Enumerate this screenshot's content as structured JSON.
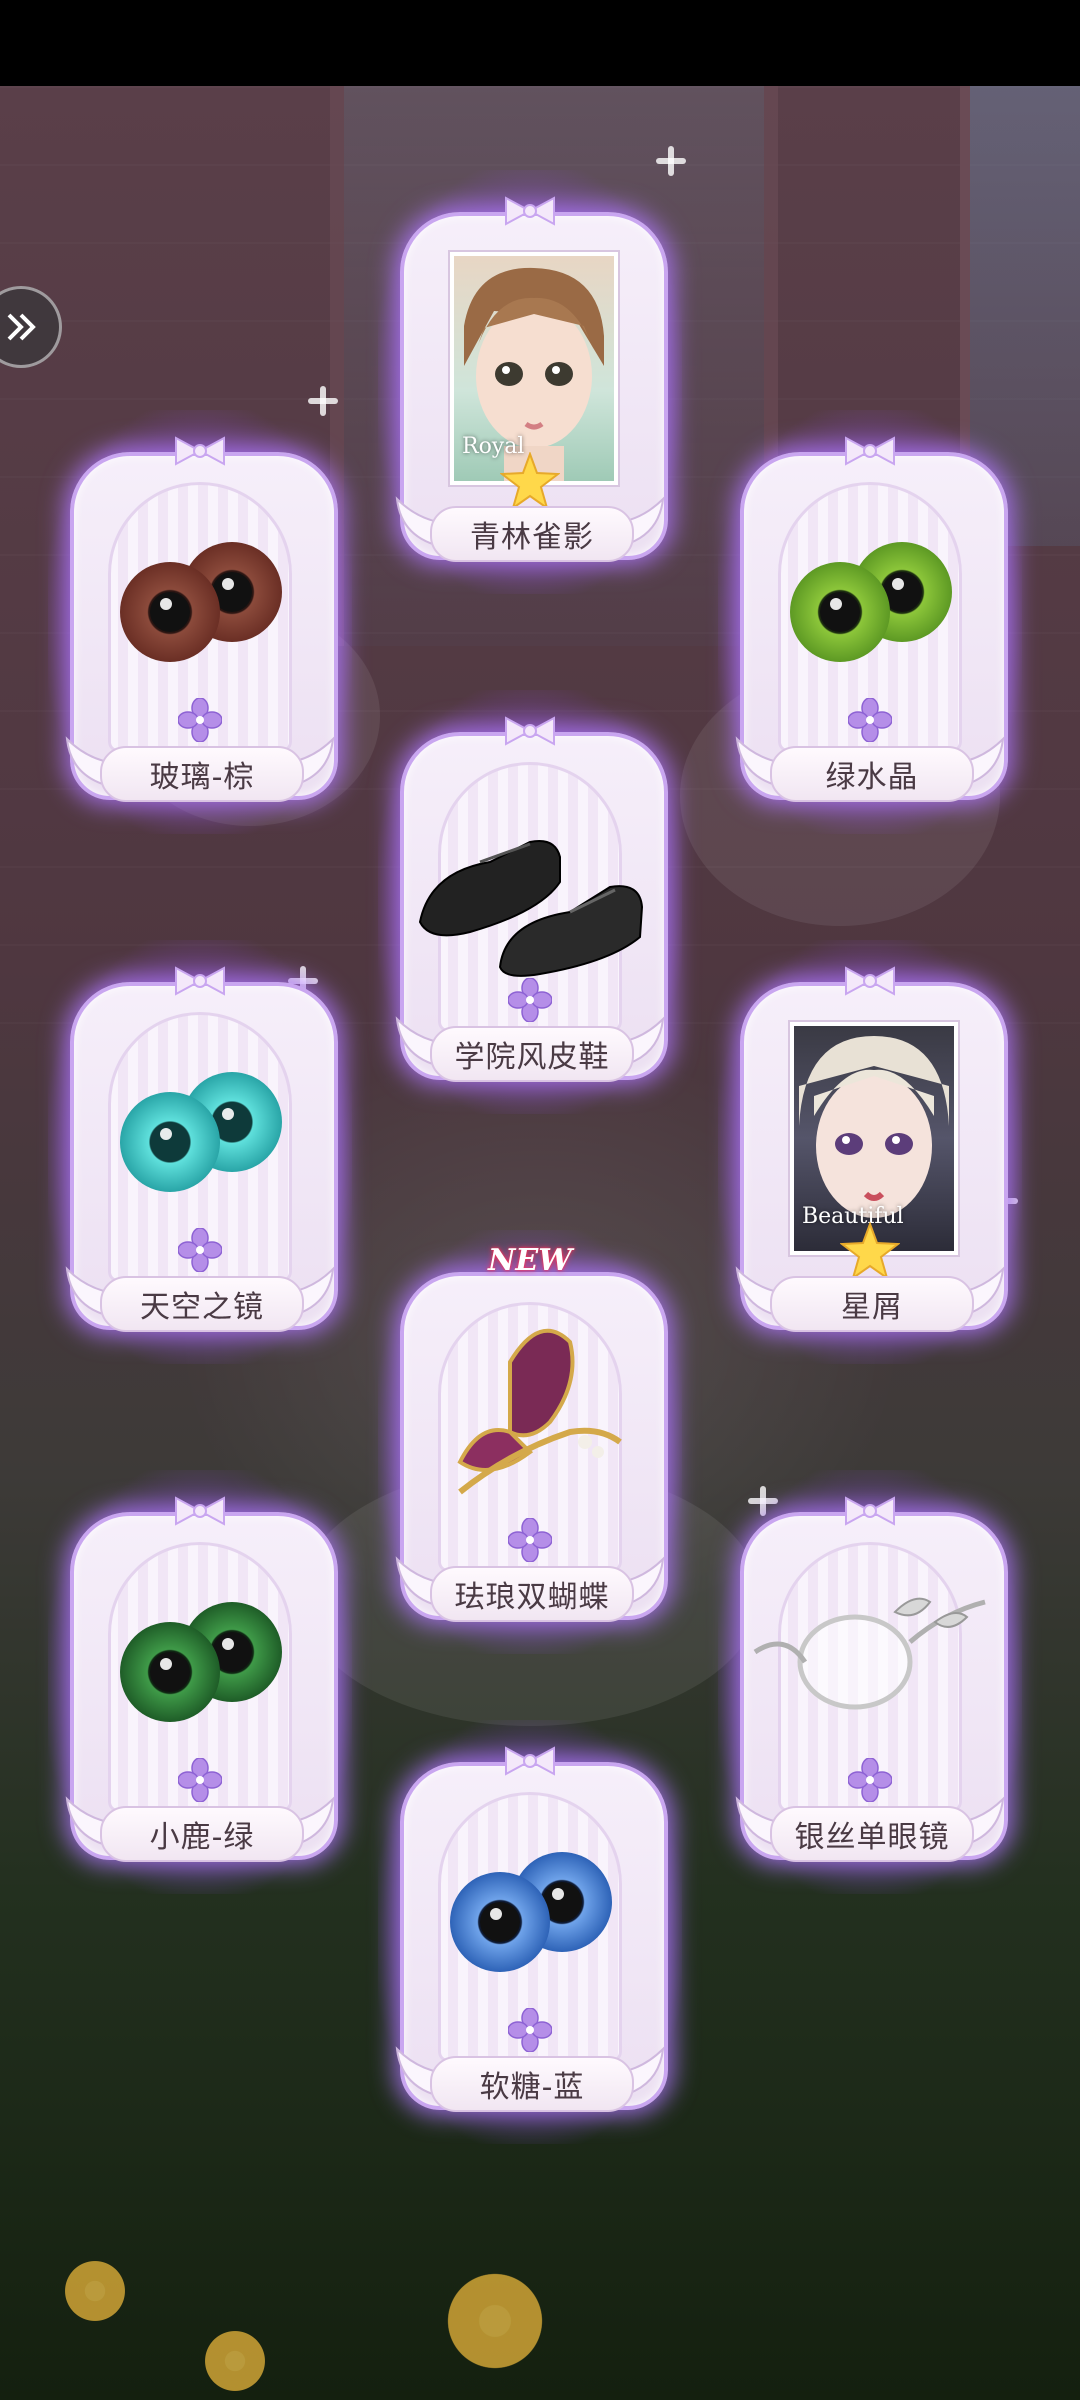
{
  "cards": [
    {
      "label": "青林雀影",
      "kind": "portrait",
      "portrait_text": "Royal",
      "rarity": "star"
    },
    {
      "label": "玻璃-棕",
      "kind": "eyes",
      "iris_color": "#8b4a3b",
      "rarity": "flower"
    },
    {
      "label": "绿水晶",
      "kind": "eyes",
      "iris_color": "#6fae2a",
      "rarity": "flower"
    },
    {
      "label": "学院风皮鞋",
      "kind": "shoes",
      "rarity": "flower"
    },
    {
      "label": "天空之镜",
      "kind": "eyes",
      "iris_color": "#36c4c8",
      "rarity": "flower"
    },
    {
      "label": "星屑",
      "kind": "portrait",
      "portrait_text": "Beautiful",
      "rarity": "star"
    },
    {
      "label": "珐琅双蝴蝶",
      "kind": "butterfly",
      "badge": "NEW",
      "rarity": "flower"
    },
    {
      "label": "小鹿-绿",
      "kind": "eyes",
      "iris_color": "#2f8a3a",
      "rarity": "flower"
    },
    {
      "label": "银丝单眼镜",
      "kind": "monocle",
      "rarity": "flower"
    },
    {
      "label": "软糖-蓝",
      "kind": "eyes",
      "iris_color": "#3c79d1",
      "rarity": "flower"
    }
  ],
  "colors": {
    "glow": "#a96cff",
    "frame_border": "#c9a6f0",
    "label_text": "#4a3a44"
  }
}
